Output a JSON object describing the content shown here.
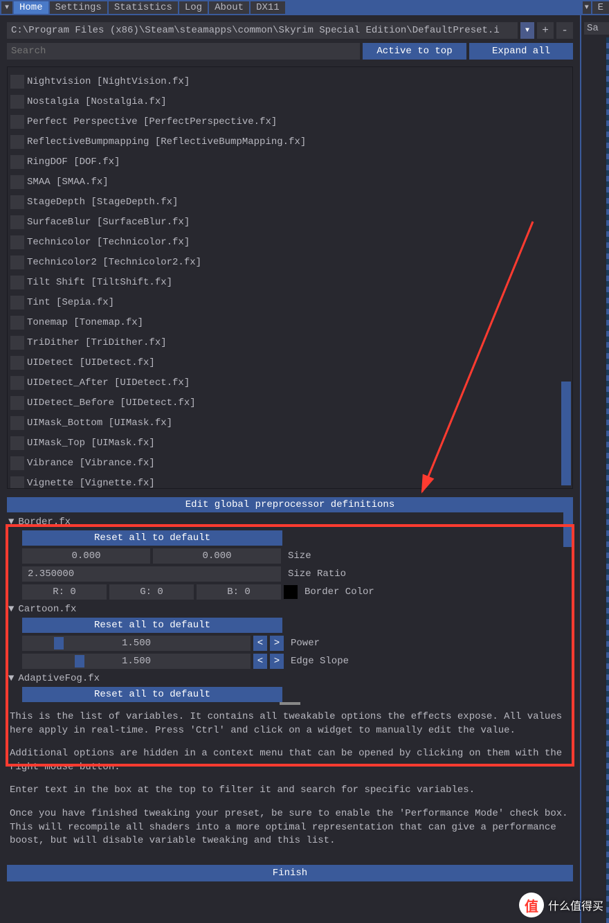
{
  "tabs": [
    "Home",
    "Settings",
    "Statistics",
    "Log",
    "About",
    "DX11"
  ],
  "active_tab": "Home",
  "path": "C:\\Program Files (x86)\\Steam\\steamapps\\common\\Skyrim Special Edition\\DefaultPreset.i",
  "search_placeholder": "Search",
  "btn_active_top": "Active to top",
  "btn_expand_all": "Expand all",
  "right_btn": "E",
  "right_save": "Sa",
  "effects": [
    "Nightvision [NightVision.fx]",
    "Nostalgia [Nostalgia.fx]",
    "Perfect Perspective [PerfectPerspective.fx]",
    "ReflectiveBumpmapping [ReflectiveBumpMapping.fx]",
    "RingDOF [DOF.fx]",
    "SMAA [SMAA.fx]",
    "StageDepth [StageDepth.fx]",
    "SurfaceBlur [SurfaceBlur.fx]",
    "Technicolor [Technicolor.fx]",
    "Technicolor2 [Technicolor2.fx]",
    "Tilt Shift [TiltShift.fx]",
    "Tint [Sepia.fx]",
    "Tonemap [Tonemap.fx]",
    "TriDither [TriDither.fx]",
    "UIDetect [UIDetect.fx]",
    "UIDetect_After [UIDetect.fx]",
    "UIDetect_Before [UIDetect.fx]",
    "UIMask_Bottom [UIMask.fx]",
    "UIMask_Top [UIMask.fx]",
    "Vibrance [Vibrance.fx]",
    "Vignette [Vignette.fx]"
  ],
  "params_header": "Edit global preprocessor definitions",
  "reset_label": "Reset all to default",
  "groups": {
    "border": {
      "name": "Border.fx",
      "size_a": "0.000",
      "size_b": "0.000",
      "size_label": "Size",
      "ratio": "2.350000",
      "ratio_label": "Size Ratio",
      "r": "R:  0",
      "g": "G:  0",
      "b": "B:  0",
      "color_label": "Border Color"
    },
    "cartoon": {
      "name": "Cartoon.fx",
      "power_val": "1.500",
      "power_label": "Power",
      "slope_val": "1.500",
      "slope_label": "Edge Slope"
    },
    "fog": {
      "name": "AdaptiveFog.fx"
    }
  },
  "help": {
    "p1": "This is the list of variables. It contains all tweakable options the effects expose. All values here apply in real-time. Press 'Ctrl' and click on a widget to manually edit the value.",
    "p2": "Additional options are hidden in a context menu that can be opened by clicking on them with the right mouse button.",
    "p3": "Enter text in the box at the top to filter it and search for specific variables.",
    "p4": "Once you have finished tweaking your preset, be sure to enable the 'Performance Mode' check box. This will recompile all shaders into a more optimal representation that can give a performance boost, but will disable variable tweaking and this list."
  },
  "finish": "Finish",
  "watermark": "什么值得买"
}
